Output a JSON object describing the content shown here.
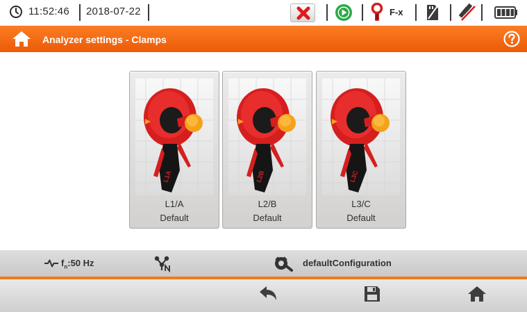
{
  "status": {
    "time": "11:52:46",
    "date": "2018-07-22",
    "fx_label": "F-x",
    "icons": [
      "clock-icon",
      "error-x-icon",
      "record-play-icon",
      "clamp-status-icon",
      "memory-card-icon",
      "usb-icon",
      "battery-icon"
    ],
    "colors": {
      "error": "#e01b1b",
      "play": "#2aa845",
      "clamp": "#d02020"
    }
  },
  "titlebar": {
    "title": "Analyzer settings - Clamps",
    "color": "#f26a12"
  },
  "clamps": [
    {
      "name": "L1/A",
      "type": "Default"
    },
    {
      "name": "L2/B",
      "type": "Default"
    },
    {
      "name": "L3/C",
      "type": "Default"
    }
  ],
  "infobar": {
    "frequency": "f",
    "frequency_sub": "n",
    "frequency_value": ":50 Hz",
    "config_name": "defaultConfiguration"
  },
  "toolbar": {
    "buttons": [
      "back-icon",
      "save-icon",
      "home-icon"
    ]
  }
}
